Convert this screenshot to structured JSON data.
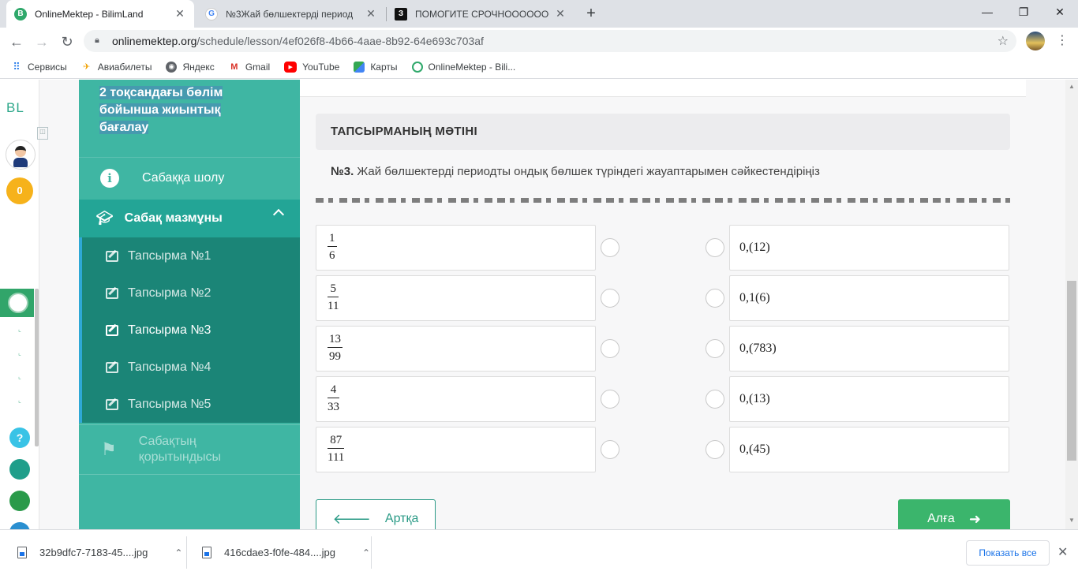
{
  "browser": {
    "tabs": [
      {
        "title": "OnlineMektep - BilimLand",
        "active": true
      },
      {
        "title": "№3Жай бөлшектерді период",
        "active": false
      },
      {
        "title": "ПОМОГИТЕ СРОЧНООООООО",
        "active": false
      }
    ],
    "url_host": "onlinemektep.org",
    "url_path": "/schedule/lesson/4ef026f8-4b66-4aae-8b92-64e693c703af",
    "bookmarks": [
      {
        "label": "Сервисы",
        "icon": "apps-grid-icon"
      },
      {
        "label": "Авиабилеты",
        "icon": "plane-icon"
      },
      {
        "label": "Яндекс",
        "icon": "globe-icon"
      },
      {
        "label": "Gmail",
        "icon": "gmail-icon"
      },
      {
        "label": "YouTube",
        "icon": "youtube-icon"
      },
      {
        "label": "Карты",
        "icon": "maps-icon"
      },
      {
        "label": "OnlineMektep - Bili...",
        "icon": "onlinemektep-icon"
      }
    ]
  },
  "rail": {
    "logo": "BL",
    "coins": "0",
    "help": "?"
  },
  "sidebar": {
    "heading": "2 тоқсандағы бөлім бойынша жиынтық бағалау",
    "overview": "Сабаққа шолу",
    "content": "Сабақ мазмұны",
    "tasks": [
      "Тапсырма №1",
      "Тапсырма №2",
      "Тапсырма №3",
      "Тапсырма №4",
      "Тапсырма №5"
    ],
    "current_task": 2,
    "conclusion": "Сабақтың қорытындысы"
  },
  "task": {
    "header": "ТАПСЫРМАНЫҢ МӘТІНІ",
    "number": "№3.",
    "question": " Жай бөлшектерді периодты ондық бөлшек түріндегі жауаптарымен сәйкестендіріңіз",
    "left": [
      {
        "num": "1",
        "den": "6"
      },
      {
        "num": "5",
        "den": "11"
      },
      {
        "num": "13",
        "den": "99"
      },
      {
        "num": "4",
        "den": "33"
      },
      {
        "num": "87",
        "den": "111"
      }
    ],
    "right": [
      "0,(12)",
      "0,1(6)",
      "0,(783)",
      "0,(13)",
      "0,(45)"
    ],
    "back": "Артқа",
    "next": "Алға"
  },
  "downloads": {
    "items": [
      "32b9dfc7-7183-45....jpg",
      "416cdae3-f0fe-484....jpg"
    ],
    "show_all": "Показать все"
  },
  "colors": {
    "sidebar": "#3fb6a3",
    "sidebar_active": "#23a596",
    "tasks_bg": "#1b8577",
    "next_button": "#3bb56c"
  }
}
